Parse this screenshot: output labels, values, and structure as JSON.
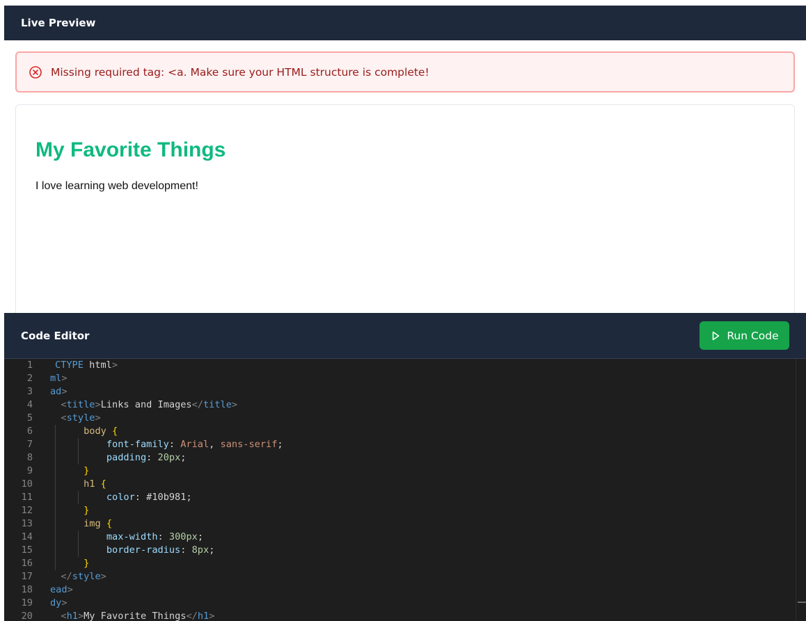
{
  "preview_panel": {
    "title": "Live Preview",
    "error_message": "Missing required tag: <a. Make sure your HTML structure is complete!",
    "content": {
      "heading": "My Favorite Things",
      "paragraph": "I love learning web development!"
    }
  },
  "editor_panel": {
    "title": "Code Editor",
    "run_button_label": "Run Code",
    "colors": {
      "background": "#1e1e1e",
      "header": "#1e293b",
      "run_button": "#16a34a",
      "heading_preview": "#10b981",
      "error_text": "#991b1b"
    },
    "lines": [
      {
        "n": "1",
        "tokens": [
          {
            "t": "CTYPE",
            "c": "tag",
            "partial": true
          },
          {
            "t": " ",
            "c": "plain"
          },
          {
            "t": "html",
            "c": "text"
          },
          {
            "t": ">",
            "c": "punct"
          }
        ]
      },
      {
        "n": "2",
        "tokens": [
          {
            "t": "ml",
            "c": "tag"
          },
          {
            "t": ">",
            "c": "punct"
          }
        ]
      },
      {
        "n": "3",
        "tokens": [
          {
            "t": "ad",
            "c": "tag"
          },
          {
            "t": ">",
            "c": "punct"
          }
        ]
      },
      {
        "n": "4",
        "tokens": [
          {
            "t": "  ",
            "c": "plain"
          },
          {
            "t": "<",
            "c": "punct"
          },
          {
            "t": "title",
            "c": "tag"
          },
          {
            "t": ">",
            "c": "punct"
          },
          {
            "t": "Links and Images",
            "c": "text"
          },
          {
            "t": "</",
            "c": "punct"
          },
          {
            "t": "title",
            "c": "tag"
          },
          {
            "t": ">",
            "c": "punct"
          }
        ]
      },
      {
        "n": "5",
        "tokens": [
          {
            "t": "  ",
            "c": "plain"
          },
          {
            "t": "<",
            "c": "punct"
          },
          {
            "t": "style",
            "c": "tag"
          },
          {
            "t": ">",
            "c": "punct"
          }
        ]
      },
      {
        "n": "6",
        "tokens": [
          {
            "t": "      ",
            "c": "plain"
          },
          {
            "t": "body",
            "c": "sel"
          },
          {
            "t": " ",
            "c": "plain"
          },
          {
            "t": "{",
            "c": "brace"
          }
        ]
      },
      {
        "n": "7",
        "tokens": [
          {
            "t": "          ",
            "c": "plain"
          },
          {
            "t": "font-family",
            "c": "prop"
          },
          {
            "t": ": ",
            "c": "plain"
          },
          {
            "t": "Arial",
            "c": "str"
          },
          {
            "t": ", ",
            "c": "plain"
          },
          {
            "t": "sans-serif",
            "c": "str"
          },
          {
            "t": ";",
            "c": "plain"
          }
        ]
      },
      {
        "n": "8",
        "tokens": [
          {
            "t": "          ",
            "c": "plain"
          },
          {
            "t": "padding",
            "c": "prop"
          },
          {
            "t": ": ",
            "c": "plain"
          },
          {
            "t": "20px",
            "c": "num"
          },
          {
            "t": ";",
            "c": "plain"
          }
        ]
      },
      {
        "n": "9",
        "tokens": [
          {
            "t": "      ",
            "c": "plain"
          },
          {
            "t": "}",
            "c": "brace"
          }
        ]
      },
      {
        "n": "10",
        "tokens": [
          {
            "t": "      ",
            "c": "plain"
          },
          {
            "t": "h1",
            "c": "sel"
          },
          {
            "t": " ",
            "c": "plain"
          },
          {
            "t": "{",
            "c": "brace"
          }
        ]
      },
      {
        "n": "11",
        "tokens": [
          {
            "t": "          ",
            "c": "plain"
          },
          {
            "t": "color",
            "c": "prop"
          },
          {
            "t": ": ",
            "c": "plain"
          },
          {
            "t": "#10b981",
            "c": "plain"
          },
          {
            "t": ";",
            "c": "plain"
          }
        ]
      },
      {
        "n": "12",
        "tokens": [
          {
            "t": "      ",
            "c": "plain"
          },
          {
            "t": "}",
            "c": "brace"
          }
        ]
      },
      {
        "n": "13",
        "tokens": [
          {
            "t": "      ",
            "c": "plain"
          },
          {
            "t": "img",
            "c": "sel"
          },
          {
            "t": " ",
            "c": "plain"
          },
          {
            "t": "{",
            "c": "brace"
          }
        ]
      },
      {
        "n": "14",
        "tokens": [
          {
            "t": "          ",
            "c": "plain"
          },
          {
            "t": "max-width",
            "c": "prop"
          },
          {
            "t": ": ",
            "c": "plain"
          },
          {
            "t": "300px",
            "c": "num"
          },
          {
            "t": ";",
            "c": "plain"
          }
        ]
      },
      {
        "n": "15",
        "tokens": [
          {
            "t": "          ",
            "c": "plain"
          },
          {
            "t": "border-radius",
            "c": "prop"
          },
          {
            "t": ": ",
            "c": "plain"
          },
          {
            "t": "8px",
            "c": "num"
          },
          {
            "t": ";",
            "c": "plain"
          }
        ]
      },
      {
        "n": "16",
        "tokens": [
          {
            "t": "      ",
            "c": "plain"
          },
          {
            "t": "}",
            "c": "brace"
          }
        ]
      },
      {
        "n": "17",
        "tokens": [
          {
            "t": "  ",
            "c": "plain"
          },
          {
            "t": "</",
            "c": "punct"
          },
          {
            "t": "style",
            "c": "tag"
          },
          {
            "t": ">",
            "c": "punct"
          }
        ]
      },
      {
        "n": "18",
        "tokens": [
          {
            "t": "ead",
            "c": "tag"
          },
          {
            "t": ">",
            "c": "punct"
          }
        ]
      },
      {
        "n": "19",
        "tokens": [
          {
            "t": "dy",
            "c": "tag"
          },
          {
            "t": ">",
            "c": "punct"
          }
        ]
      },
      {
        "n": "20",
        "tokens": [
          {
            "t": "  ",
            "c": "plain"
          },
          {
            "t": "<",
            "c": "punct"
          },
          {
            "t": "h1",
            "c": "tag"
          },
          {
            "t": ">",
            "c": "punct"
          },
          {
            "t": "My Favorite Things",
            "c": "text"
          },
          {
            "t": "</",
            "c": "punct"
          },
          {
            "t": "h1",
            "c": "tag"
          },
          {
            "t": ">",
            "c": "punct"
          }
        ]
      }
    ]
  }
}
